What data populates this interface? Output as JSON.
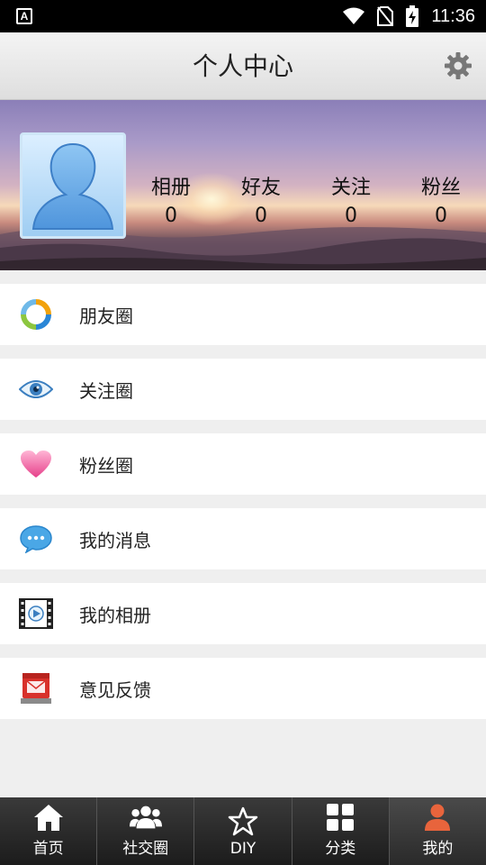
{
  "status_bar": {
    "notification_badge": "A",
    "time": "11:36",
    "icons": [
      "wifi-icon",
      "no-sim-icon",
      "battery-charging-icon"
    ]
  },
  "header": {
    "title": "个人中心",
    "settings_icon": "gear-icon"
  },
  "profile": {
    "avatar_icon": "default-avatar-icon",
    "stats": [
      {
        "label": "相册",
        "value": "0"
      },
      {
        "label": "好友",
        "value": "0"
      },
      {
        "label": "关注",
        "value": "0"
      },
      {
        "label": "粉丝",
        "value": "0"
      }
    ]
  },
  "menu": {
    "items": [
      {
        "label": "朋友圈",
        "icon": "moments-ring-icon"
      },
      {
        "label": "关注圈",
        "icon": "eye-icon"
      },
      {
        "label": "粉丝圈",
        "icon": "heart-icon"
      },
      {
        "label": "我的消息",
        "icon": "chat-bubble-icon"
      },
      {
        "label": "我的相册",
        "icon": "film-play-icon"
      },
      {
        "label": "意见反馈",
        "icon": "mailbox-icon"
      }
    ]
  },
  "tabbar": {
    "tabs": [
      {
        "label": "首页",
        "icon": "home-icon",
        "active": false
      },
      {
        "label": "社交圈",
        "icon": "people-icon",
        "active": false
      },
      {
        "label": "DIY",
        "icon": "star-outline-icon",
        "active": false
      },
      {
        "label": "分类",
        "icon": "grid-icon",
        "active": false
      },
      {
        "label": "我的",
        "icon": "user-icon",
        "active": true
      }
    ]
  },
  "colors": {
    "status_bar": "#000000",
    "header_bg": "#e8e8e8",
    "tabbar_bg": "#2a2a2a",
    "page_bg": "#efefef"
  }
}
